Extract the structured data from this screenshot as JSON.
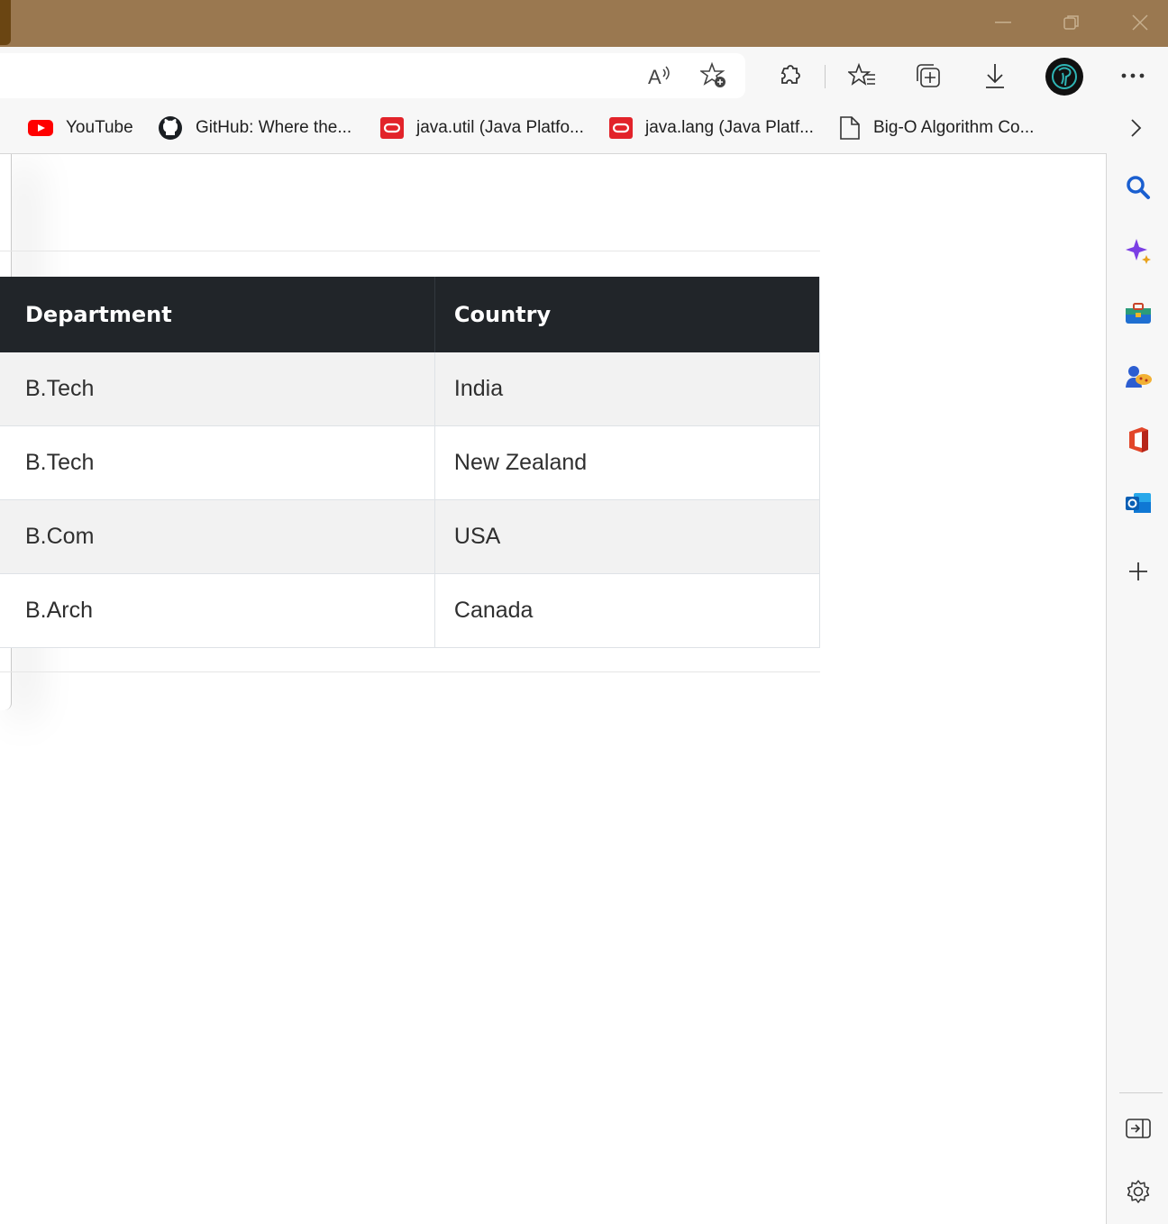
{
  "bookmarks": [
    {
      "label": "YouTube",
      "icon": "youtube-icon"
    },
    {
      "label": "GitHub: Where the...",
      "icon": "github-icon"
    },
    {
      "label": "java.util (Java Platfo...",
      "icon": "oracle-icon"
    },
    {
      "label": "java.lang (Java Platf...",
      "icon": "oracle-icon"
    },
    {
      "label": "Big-O Algorithm Co...",
      "icon": "page-icon"
    }
  ],
  "table": {
    "headers": [
      "Department",
      "Country"
    ],
    "rows": [
      [
        "B.Tech",
        "India"
      ],
      [
        "B.Tech",
        "New Zealand"
      ],
      [
        "B.Com",
        "USA"
      ],
      [
        "B.Arch",
        "Canada"
      ]
    ]
  },
  "colors": {
    "titlebar": "#9a7850",
    "table_header": "#212529",
    "youtube_red": "#ff0000",
    "oracle_red": "#e2232a"
  }
}
